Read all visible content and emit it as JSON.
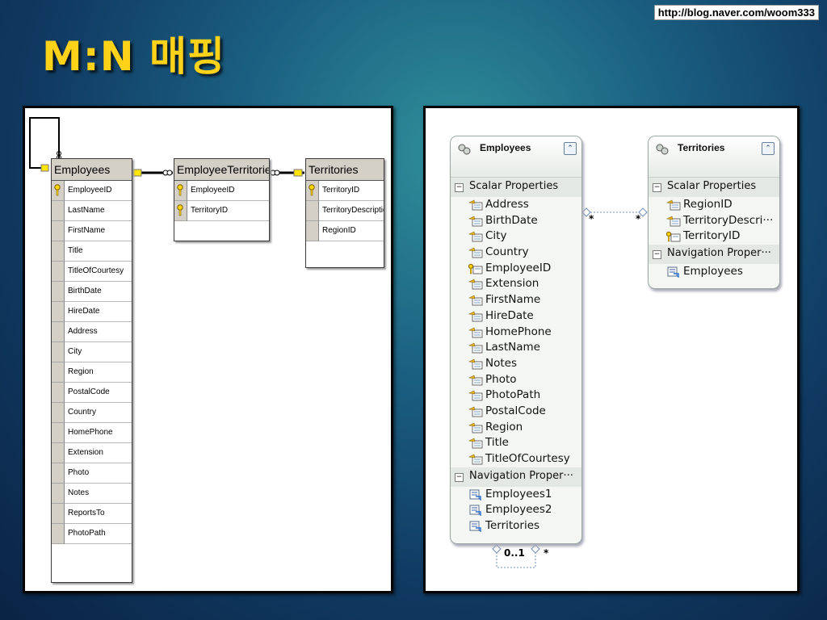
{
  "title": "M:N 매핑",
  "watermark": "http://blog.naver.com/woom333",
  "colors": {
    "title": "#ffd21a",
    "background": "#103a62",
    "panel": "#ffffff"
  },
  "sql_diagram": {
    "employees": {
      "name": "Employees",
      "columns": [
        "EmployeeID",
        "LastName",
        "FirstName",
        "Title",
        "TitleOfCourtesy",
        "BirthDate",
        "HireDate",
        "Address",
        "City",
        "Region",
        "PostalCode",
        "Country",
        "HomePhone",
        "Extension",
        "Photo",
        "Notes",
        "ReportsTo",
        "PhotoPath"
      ],
      "key_columns": [
        "EmployeeID"
      ]
    },
    "employee_territories": {
      "name": "EmployeeTerritories",
      "columns": [
        "EmployeeID",
        "TerritoryID"
      ],
      "key_columns": [
        "EmployeeID",
        "TerritoryID"
      ]
    },
    "territories": {
      "name": "Territories",
      "columns": [
        "TerritoryID",
        "TerritoryDescription",
        "RegionID"
      ],
      "key_columns": [
        "TerritoryID"
      ]
    }
  },
  "entity_diagram": {
    "employees": {
      "name": "Employees",
      "scalar_label": "Scalar Properties",
      "scalar_properties": [
        "Address",
        "BirthDate",
        "City",
        "Country",
        "EmployeeID",
        "Extension",
        "FirstName",
        "HireDate",
        "HomePhone",
        "LastName",
        "Notes",
        "Photo",
        "PhotoPath",
        "PostalCode",
        "Region",
        "Title",
        "TitleOfCourtesy"
      ],
      "key_properties": [
        "EmployeeID"
      ],
      "nav_label": "Navigation Proper···",
      "navigation_properties": [
        "Employees1",
        "Employees2",
        "Territories"
      ]
    },
    "territories": {
      "name": "Territories",
      "scalar_label": "Scalar Properties",
      "scalar_properties": [
        "RegionID",
        "TerritoryDescri···",
        "TerritoryID"
      ],
      "key_properties": [
        "TerritoryID"
      ],
      "nav_label": "Navigation Proper···",
      "navigation_properties": [
        "Employees"
      ]
    },
    "multiplicity": {
      "many_left": "*",
      "many_right": "*",
      "self_zero_one": "0..1",
      "self_many": "*"
    }
  }
}
